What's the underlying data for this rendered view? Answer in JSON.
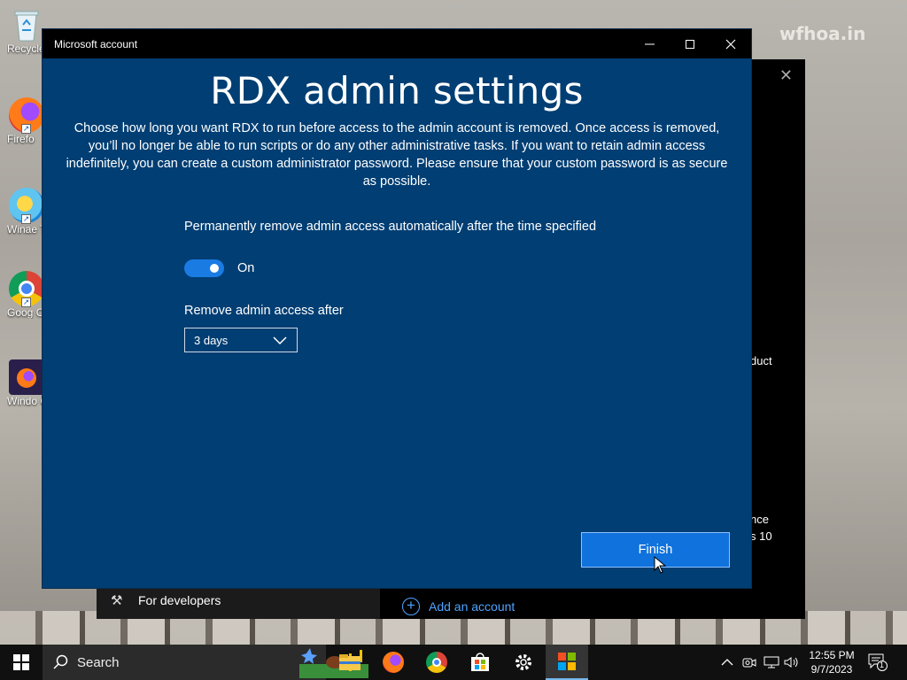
{
  "desktop": {
    "icons": [
      {
        "label": "Recycle",
        "icon": "recycle-bin-icon"
      },
      {
        "label": "Firefo",
        "icon": "firefox-icon"
      },
      {
        "label": "Winae Tweak",
        "icon": "winaero-tweaker-icon"
      },
      {
        "label": "Goog Chron",
        "icon": "chrome-icon"
      },
      {
        "label": "Windo Compat",
        "icon": "windows-compat-icon"
      }
    ],
    "wallpaper_logo": "wfhoa.in"
  },
  "background_window": {
    "sidebar_item": "For developers",
    "add_account": "Add an account",
    "peek_text_1": "duct",
    "peek_text_2": "nce",
    "peek_text_3": "s 10"
  },
  "dialog": {
    "window_title": "Microsoft account",
    "heading": "RDX admin settings",
    "description": "Choose how long you want RDX to run before access to the admin account is removed. Once access is removed, you’ll no longer be able to run scripts or do any other administrative tasks. If you want to retain admin access indefinitely, you can create a custom administrator password. Please ensure that your custom password is as secure as possible.",
    "toggle_label": "Permanently remove admin access automatically after the time specified",
    "toggle_state": "On",
    "select_label": "Remove admin access after",
    "select_value": "3 days",
    "finish_label": "Finish"
  },
  "taskbar": {
    "search_label": "Search",
    "time": "12:55 PM",
    "date": "9/7/2023",
    "notification_count": "1",
    "pinned": [
      "file-explorer-icon",
      "firefox-icon",
      "chrome-icon",
      "store-icon",
      "settings-icon",
      "app-icon"
    ]
  },
  "colors": {
    "dialog_bg": "#003e73",
    "accent": "#1072dc",
    "toggle_on": "#1a7be3",
    "taskbar": "#101010"
  }
}
